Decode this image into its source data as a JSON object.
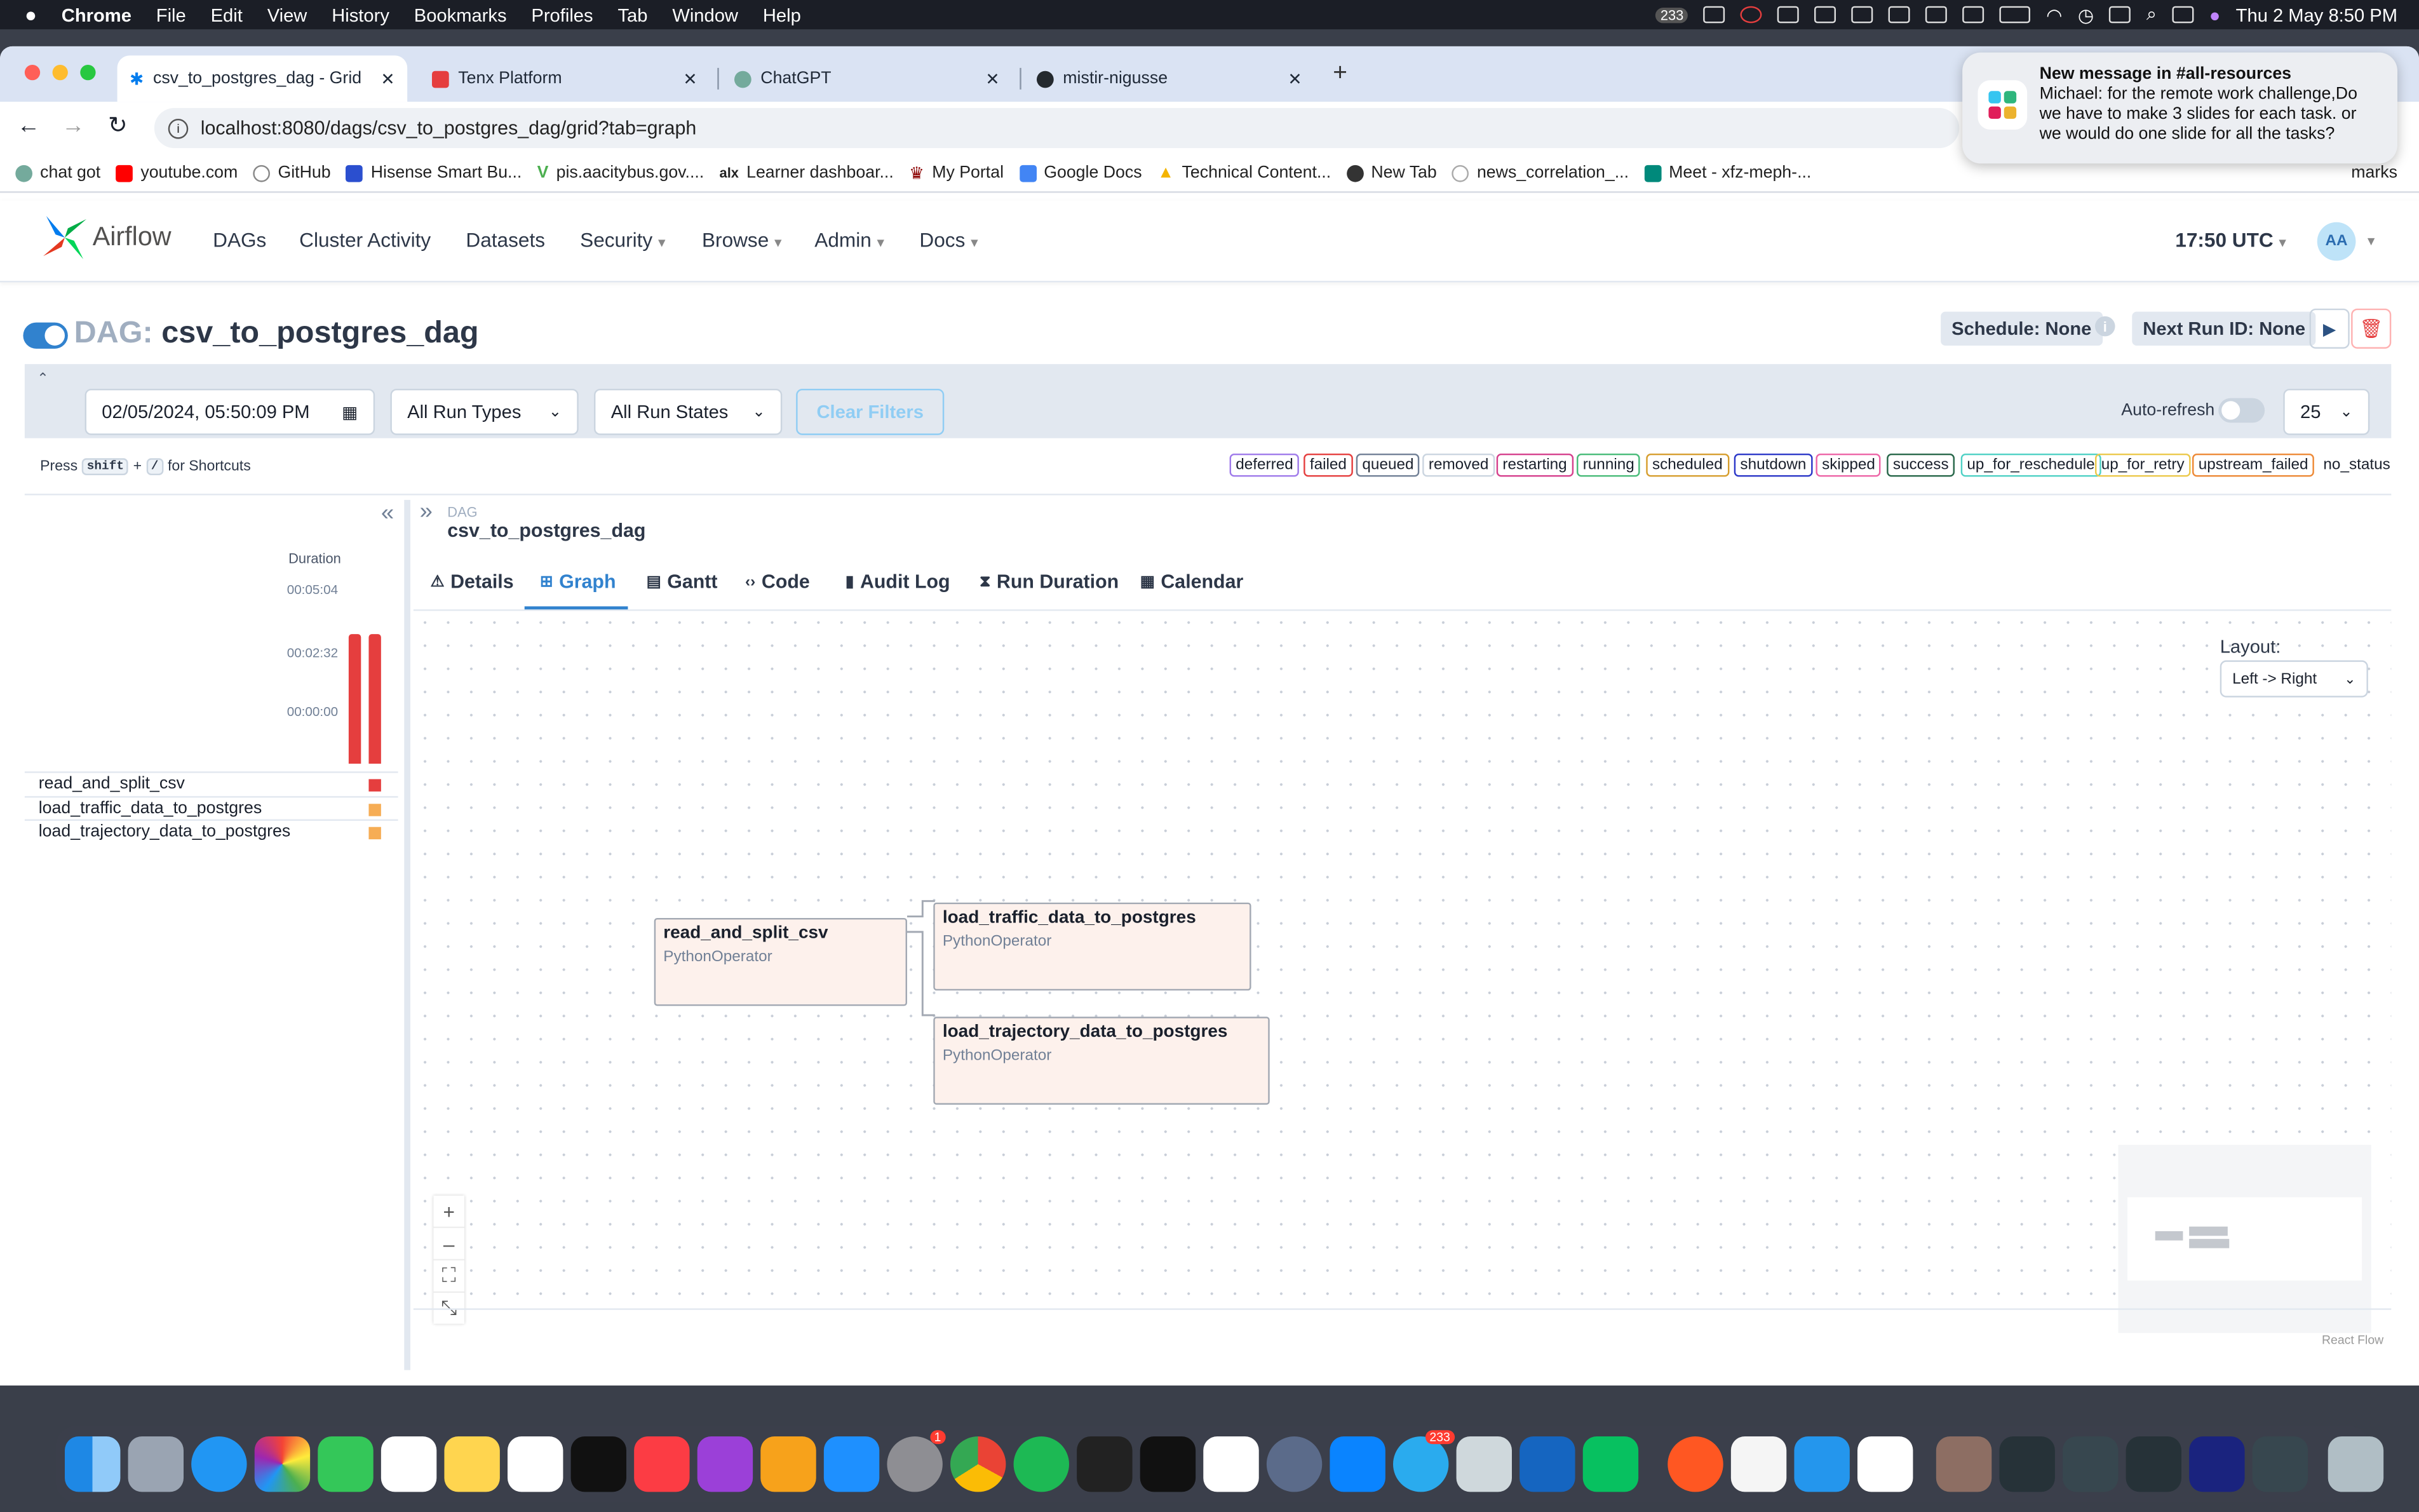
{
  "menubar": {
    "app": "Chrome",
    "items": [
      "File",
      "Edit",
      "View",
      "History",
      "Bookmarks",
      "Profiles",
      "Tab",
      "Window",
      "Help"
    ],
    "badge_count": "233",
    "clock": "Thu 2 May  8:50 PM"
  },
  "browser": {
    "tabs": [
      {
        "label": "csv_to_postgres_dag - Grid"
      },
      {
        "label": "Tenx Platform"
      },
      {
        "label": "ChatGPT"
      },
      {
        "label": "mistir-nigusse"
      }
    ],
    "url": "localhost:8080/dags/csv_to_postgres_dag/grid?tab=graph",
    "bookmarks": [
      "chat got",
      "youtube.com",
      "GitHub",
      "Hisense Smart Bu...",
      "pis.aacitybus.gov....",
      "Learner dashboar...",
      "My Portal",
      "Google Docs",
      "Technical Content...",
      "New Tab",
      "news_correlation_...",
      "Meet - xfz-meph-..."
    ],
    "bookmarks_tail": "marks"
  },
  "notification": {
    "title": "New message in #all-resources",
    "body": "Michael: for the remote work challenge,Do we have to make 3 slides for each task. or we would do one slide for all the tasks?"
  },
  "airflow": {
    "brand": "Airflow",
    "nav": [
      "DAGs",
      "Cluster Activity",
      "Datasets",
      "Security",
      "Browse",
      "Admin",
      "Docs"
    ],
    "time": "17:50 UTC",
    "avatar": "AA",
    "dag_prefix": "DAG:",
    "dag_id": "csv_to_postgres_dag",
    "schedule": "Schedule: None",
    "next_run": "Next Run ID: None",
    "filters": {
      "datetime": "02/05/2024, 05:50:09 PM",
      "run_types": "All Run Types",
      "run_states": "All Run States",
      "clear": "Clear Filters",
      "auto_refresh": "Auto-refresh",
      "page_size": "25"
    },
    "shortcut_hint": {
      "press": "Press",
      "key1": "shift",
      "plus": "+",
      "key2": "/",
      "suffix": "for Shortcuts"
    },
    "states": [
      {
        "label": "deferred",
        "color": "#9f7aea"
      },
      {
        "label": "failed",
        "color": "#e53e3e"
      },
      {
        "label": "queued",
        "color": "#718096"
      },
      {
        "label": "removed",
        "color": "#cbd5e0"
      },
      {
        "label": "restarting",
        "color": "#d53f8c"
      },
      {
        "label": "running",
        "color": "#48bb78"
      },
      {
        "label": "scheduled",
        "color": "#d69e2e"
      },
      {
        "label": "shutdown",
        "color": "#2b37c8"
      },
      {
        "label": "skipped",
        "color": "#ed64a6"
      },
      {
        "label": "success",
        "color": "#276749"
      },
      {
        "label": "up_for_reschedule",
        "color": "#4fd1c5"
      },
      {
        "label": "up_for_retry",
        "color": "#ecc94b"
      },
      {
        "label": "upstream_failed",
        "color": "#ed8936"
      },
      {
        "label": "no_status",
        "color": "#ffffff"
      }
    ],
    "grid": {
      "duration_label": "Duration",
      "ticks": [
        "00:05:04",
        "00:02:32",
        "00:00:00"
      ],
      "runs": [
        {
          "duration_fraction": 1.0,
          "color": "#e53e3e"
        },
        {
          "duration_fraction": 1.0,
          "color": "#e53e3e"
        }
      ],
      "tasks": [
        {
          "name": "read_and_split_csv",
          "color": "#e53e3e"
        },
        {
          "name": "load_traffic_data_to_postgres",
          "color": "#f6ad55"
        },
        {
          "name": "load_trajectory_data_to_postgres",
          "color": "#f6ad55"
        }
      ]
    },
    "detail": {
      "kind": "DAG",
      "title": "csv_to_postgres_dag",
      "tabs": [
        "Details",
        "Graph",
        "Gantt",
        "Code",
        "Audit Log",
        "Run Duration",
        "Calendar"
      ],
      "active_tab": "Graph"
    },
    "graph": {
      "layout_label": "Layout:",
      "layout_value": "Left -> Right",
      "nodes": [
        {
          "name": "read_and_split_csv",
          "operator": "PythonOperator"
        },
        {
          "name": "load_traffic_data_to_postgres",
          "operator": "PythonOperator"
        },
        {
          "name": "load_trajectory_data_to_postgres",
          "operator": "PythonOperator"
        }
      ],
      "attribution": "React Flow"
    }
  },
  "dock": {
    "telegram_badge": "233",
    "settings_badge": "1"
  }
}
